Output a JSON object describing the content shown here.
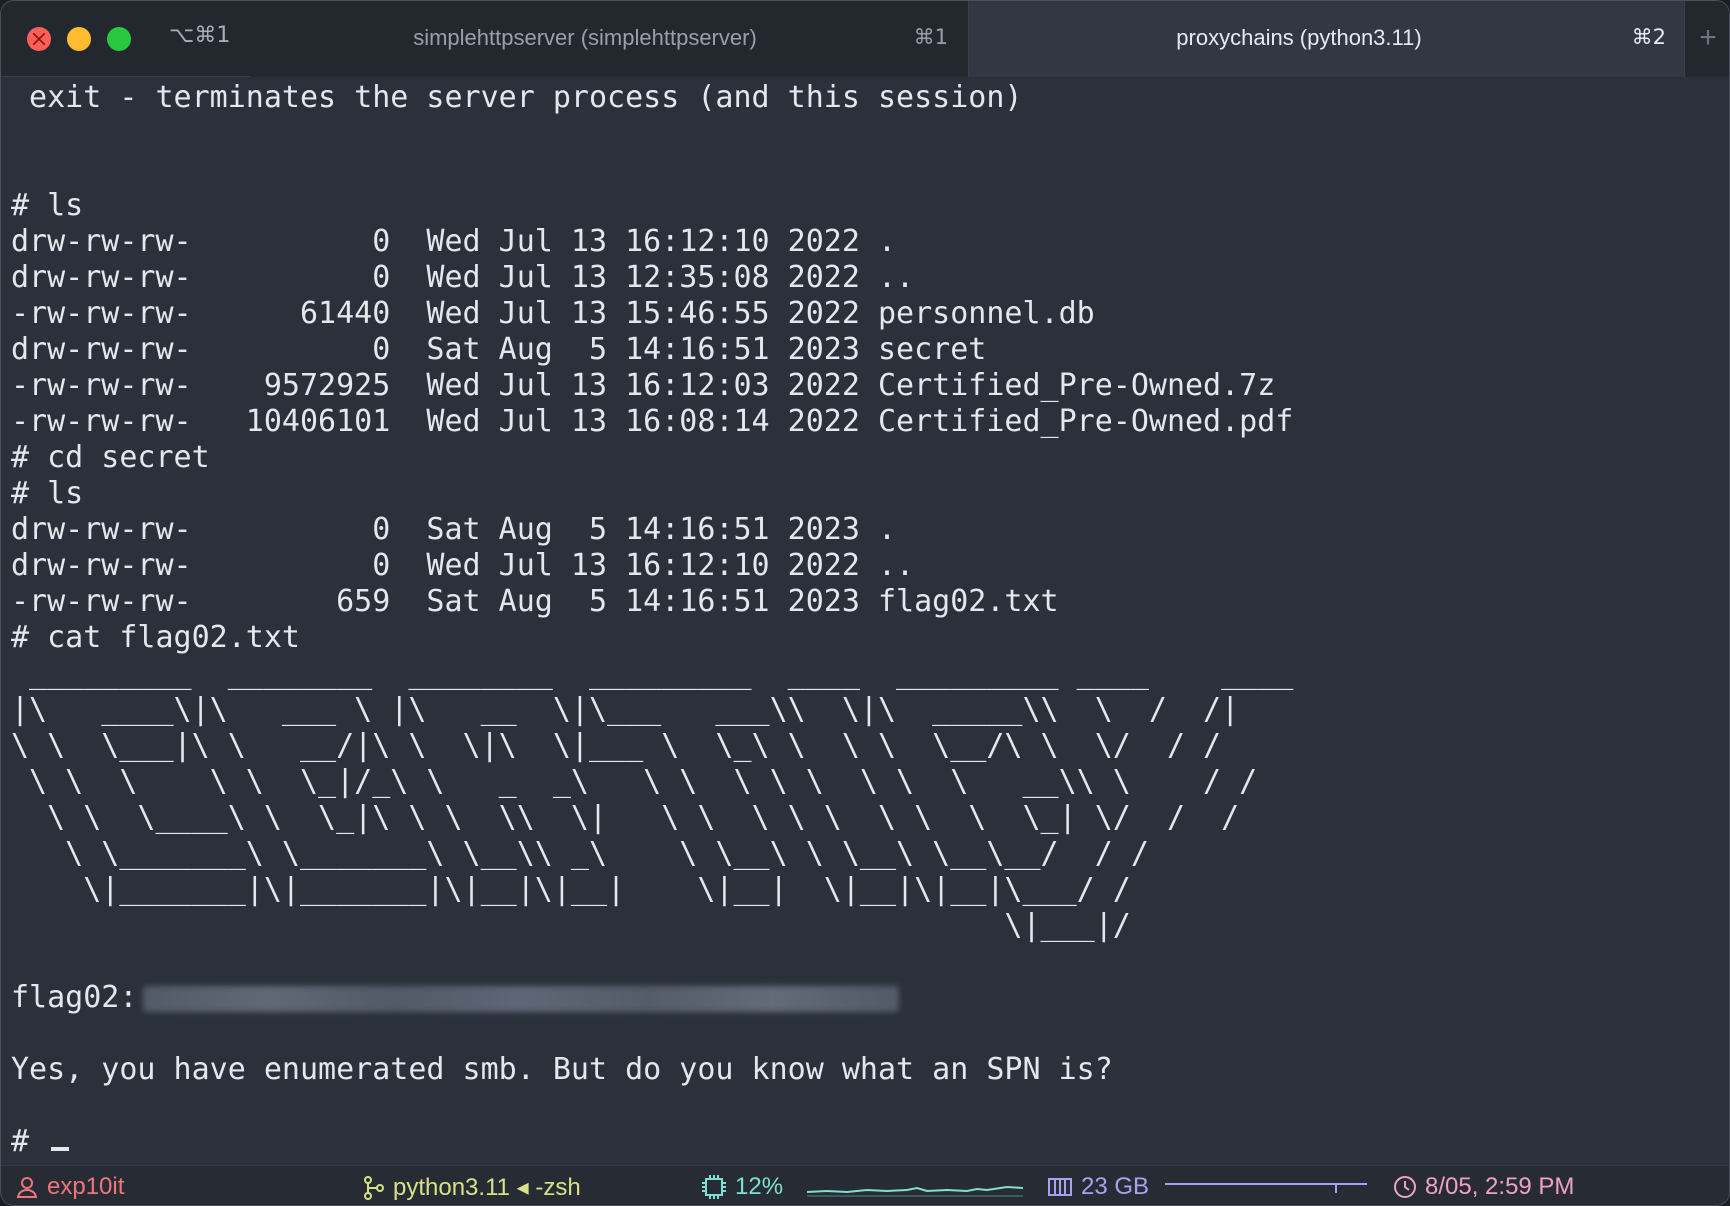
{
  "titlebar": {
    "shortcut": "⌥⌘1",
    "tabs": [
      {
        "title": "simplehttpserver (simplehttpserver)",
        "key": "⌘1"
      },
      {
        "title": "proxychains (python3.11)",
        "key": "⌘2"
      }
    ],
    "new_tab": "+"
  },
  "terminal": {
    "lines": [
      " exit - terminates the server process (and this session)",
      "",
      "",
      "# ls",
      "drw-rw-rw-          0  Wed Jul 13 16:12:10 2022 .",
      "drw-rw-rw-          0  Wed Jul 13 12:35:08 2022 ..",
      "-rw-rw-rw-      61440  Wed Jul 13 15:46:55 2022 personnel.db",
      "drw-rw-rw-          0  Sat Aug  5 14:16:51 2023 secret",
      "-rw-rw-rw-    9572925  Wed Jul 13 16:12:03 2022 Certified_Pre-Owned.7z",
      "-rw-rw-rw-   10406101  Wed Jul 13 16:08:14 2022 Certified_Pre-Owned.pdf",
      "# cd secret",
      "# ls",
      "drw-rw-rw-          0  Sat Aug  5 14:16:51 2023 .",
      "drw-rw-rw-          0  Wed Jul 13 16:12:10 2022 ..",
      "-rw-rw-rw-        659  Sat Aug  5 14:16:51 2023 flag02.txt",
      "# cat flag02.txt",
      " _________  ________  ________  _________  ____  _________ ____    ____",
      "|\\   ____\\|\\   ___ \\ |\\   __  \\|\\___   ___\\\\  \\|\\  _____\\\\  \\  /  /|",
      "\\ \\  \\___|\\ \\   __/|\\ \\  \\|\\  \\|___ \\  \\_\\ \\  \\ \\  \\__/\\ \\  \\/  / /",
      " \\ \\  \\    \\ \\  \\_|/_\\ \\   _  _\\   \\ \\  \\ \\ \\  \\ \\  \\   __\\\\ \\    / /",
      "  \\ \\  \\____\\ \\  \\_|\\ \\ \\  \\\\  \\|   \\ \\  \\ \\ \\  \\ \\  \\  \\_| \\/  /  /",
      "   \\ \\_______\\ \\_______\\ \\__\\\\ _\\    \\ \\__\\ \\ \\__\\ \\__\\__/  / /",
      "    \\|_______|\\|_______|\\|__|\\|__|    \\|__|  \\|__|\\|__|\\___/ /",
      "                                                       \\|___|/",
      ""
    ],
    "flag_label": "flag02:",
    "after_lines": [
      "",
      "Yes, you have enumerated smb. But do you know what an SPN is?",
      ""
    ],
    "prompt": "# "
  },
  "statusbar": {
    "user": "exp10it",
    "process": "python3.11 ◂ -zsh",
    "cpu": "12%",
    "memory": "23 GB",
    "datetime": "8/05, 2:59 PM",
    "colors": {
      "user": "#f0747c",
      "process": "#d8e08a",
      "cpu": "#7ee0d0",
      "memory": "#a6a2f0",
      "time": "#f0a0c8"
    }
  }
}
